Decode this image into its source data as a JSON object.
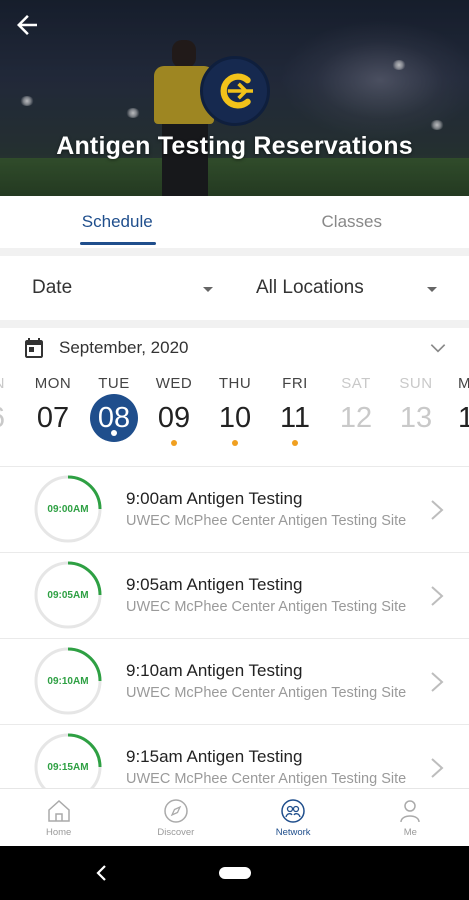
{
  "header": {
    "title": "Antigen Testing Reservations",
    "back_icon": "arrow-left-icon",
    "logo": "university-c-logo"
  },
  "tabs": [
    {
      "label": "Schedule",
      "active": true
    },
    {
      "label": "Classes",
      "active": false
    }
  ],
  "filters": {
    "date_label": "Date",
    "location_label": "All Locations"
  },
  "calendar": {
    "month_label": "September,  2020",
    "days": [
      {
        "name": "N",
        "num": "6",
        "state": "partial-left"
      },
      {
        "name": "MON",
        "num": "07",
        "state": "normal",
        "dot": false
      },
      {
        "name": "TUE",
        "num": "08",
        "state": "selected",
        "dot": true
      },
      {
        "name": "WED",
        "num": "09",
        "state": "normal",
        "dot": true
      },
      {
        "name": "THU",
        "num": "10",
        "state": "normal",
        "dot": true
      },
      {
        "name": "FRI",
        "num": "11",
        "state": "normal",
        "dot": true
      },
      {
        "name": "SAT",
        "num": "12",
        "state": "muted",
        "dot": false
      },
      {
        "name": "SUN",
        "num": "13",
        "state": "muted",
        "dot": false
      },
      {
        "name": "M",
        "num": "1",
        "state": "partial-right"
      }
    ]
  },
  "sessions": [
    {
      "time_badge": "09:00AM",
      "title": "9:00am Antigen Testing",
      "location": "UWEC McPhee Center Antigen Testing Site"
    },
    {
      "time_badge": "09:05AM",
      "title": "9:05am Antigen Testing",
      "location": "UWEC McPhee Center Antigen Testing Site"
    },
    {
      "time_badge": "09:10AM",
      "title": "9:10am Antigen Testing",
      "location": "UWEC McPhee Center Antigen Testing Site"
    },
    {
      "time_badge": "09:15AM",
      "title": "9:15am Antigen Testing",
      "location": "UWEC McPhee Center Antigen Testing Site"
    }
  ],
  "bottom_nav": [
    {
      "label": "Home",
      "icon": "home-icon",
      "active": false
    },
    {
      "label": "Discover",
      "icon": "compass-icon",
      "active": false
    },
    {
      "label": "Network",
      "icon": "network-icon",
      "active": true
    },
    {
      "label": "Me",
      "icon": "person-icon",
      "active": false
    }
  ],
  "colors": {
    "brand_blue": "#1f4e8c",
    "accent_green": "#2ea043",
    "dot_orange": "#f0a020"
  }
}
